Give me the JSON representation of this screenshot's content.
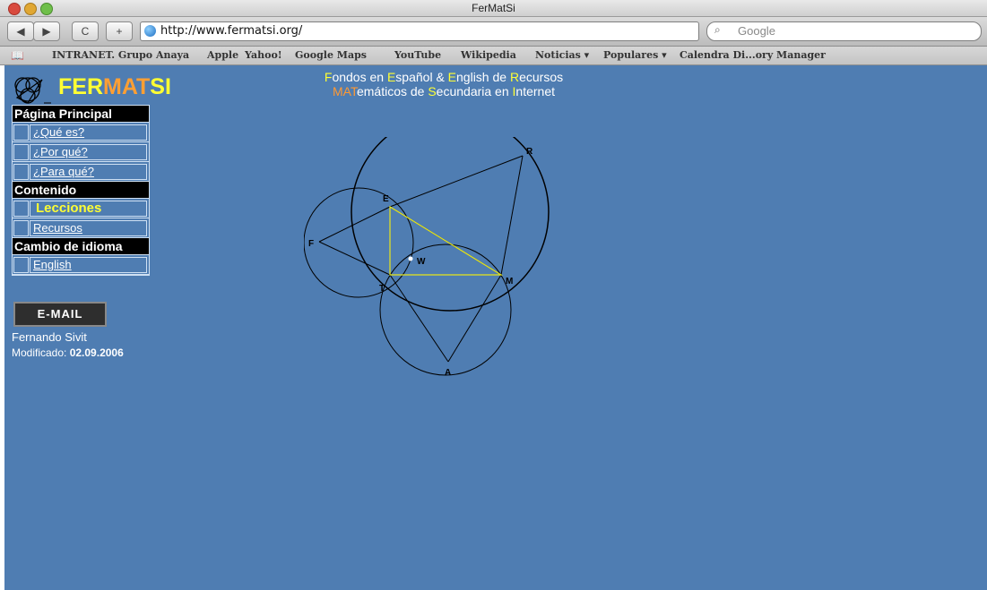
{
  "window": {
    "title": "FerMatSi"
  },
  "toolbar": {
    "back_icon": "back-arrow-icon",
    "forward_icon": "forward-arrow-icon",
    "reload_label": "C",
    "add_label": "+",
    "url": "http://www.fermatsi.org/",
    "search_placeholder": "Google"
  },
  "bookmarks": [
    "INTRANET. Grupo Anaya",
    "Apple",
    "Yahoo!",
    "Google Maps",
    "YouTube",
    "Wikipedia",
    "Noticias ▾",
    "Populares ▾",
    "Calendra Di...ory Manager"
  ],
  "logo": {
    "part1": "FER",
    "part2": "MAT",
    "part3": "SI"
  },
  "headline": {
    "line1": [
      {
        "t": "F",
        "c": "y"
      },
      {
        "t": "ondos en ",
        "c": "w"
      },
      {
        "t": "E",
        "c": "y"
      },
      {
        "t": "spañol & ",
        "c": "w"
      },
      {
        "t": "E",
        "c": "y"
      },
      {
        "t": "nglish de ",
        "c": "w"
      },
      {
        "t": "R",
        "c": "y"
      },
      {
        "t": "ecursos",
        "c": "w"
      }
    ],
    "line2": [
      {
        "t": "MAT",
        "c": "o"
      },
      {
        "t": "emáticos de ",
        "c": "w"
      },
      {
        "t": "S",
        "c": "y"
      },
      {
        "t": "ecundaria en ",
        "c": "w"
      },
      {
        "t": "I",
        "c": "y"
      },
      {
        "t": "nternet",
        "c": "w"
      }
    ]
  },
  "menu": {
    "head_main": "Página Principal",
    "que_es": "¿Qué es?",
    "por_que": "¿Por qué?",
    "para_que": "¿Para qué?",
    "head_contenido": "Contenido",
    "lecciones": "Lecciones",
    "recursos": "Recursos",
    "head_idioma": "Cambio de idioma",
    "english": "English"
  },
  "email_label": "E-MAIL",
  "author": "Fernando Sivit",
  "modified_label": "Modificado: ",
  "modified_date": "02.09.2006",
  "figure": {
    "points": [
      "R",
      "E",
      "F",
      "W",
      "T",
      "M",
      "A"
    ]
  }
}
